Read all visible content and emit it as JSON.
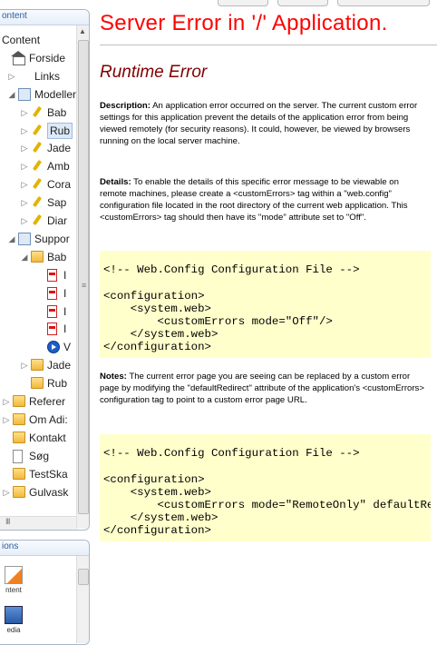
{
  "left_panel": {
    "header": "ontent",
    "tree": [
      {
        "label": "Content",
        "indent": 0,
        "icon": "none",
        "exp": ""
      },
      {
        "label": "Forside",
        "indent": 0,
        "icon": "house",
        "exp": ""
      },
      {
        "label": "Links",
        "indent": 1,
        "icon": "python",
        "exp": "▷"
      },
      {
        "label": "Modeller",
        "indent": 1,
        "icon": "globe",
        "exp": "◢"
      },
      {
        "label": "Bab",
        "indent": 2,
        "icon": "pen",
        "exp": "▷"
      },
      {
        "label": "Rub",
        "indent": 2,
        "icon": "pen",
        "exp": "▷",
        "selected": true
      },
      {
        "label": "Jade",
        "indent": 2,
        "icon": "pen",
        "exp": "▷"
      },
      {
        "label": "Amb",
        "indent": 2,
        "icon": "pen",
        "exp": "▷"
      },
      {
        "label": "Cora",
        "indent": 2,
        "icon": "pen",
        "exp": "▷"
      },
      {
        "label": "Sap",
        "indent": 2,
        "icon": "pen",
        "exp": "▷"
      },
      {
        "label": "Diar",
        "indent": 2,
        "icon": "pen",
        "exp": "▷"
      },
      {
        "label": "Suppor",
        "indent": 1,
        "icon": "globe",
        "exp": "◢"
      },
      {
        "label": "Bab",
        "indent": 2,
        "icon": "folder",
        "exp": "◢"
      },
      {
        "label": "I",
        "indent": 3,
        "icon": "pdf",
        "exp": ""
      },
      {
        "label": "I",
        "indent": 3,
        "icon": "pdf",
        "exp": ""
      },
      {
        "label": "I",
        "indent": 3,
        "icon": "pdf",
        "exp": ""
      },
      {
        "label": "I",
        "indent": 3,
        "icon": "pdf",
        "exp": ""
      },
      {
        "label": "V",
        "indent": 3,
        "icon": "play",
        "exp": ""
      },
      {
        "label": "Jade",
        "indent": 2,
        "icon": "folder",
        "exp": "▷"
      },
      {
        "label": "Rub",
        "indent": 2,
        "icon": "folder",
        "exp": ""
      },
      {
        "label": "Referer",
        "indent": 0,
        "icon": "folder",
        "exp": "▷"
      },
      {
        "label": "Om Adi:",
        "indent": 0,
        "icon": "folder",
        "exp": "▷"
      },
      {
        "label": "Kontakt",
        "indent": 0,
        "icon": "folder",
        "exp": ""
      },
      {
        "label": "Søg",
        "indent": 0,
        "icon": "doc",
        "exp": ""
      },
      {
        "label": "TestSka",
        "indent": 0,
        "icon": "folder",
        "exp": ""
      },
      {
        "label": "Gulvask",
        "indent": 0,
        "icon": "folder",
        "exp": "▷"
      }
    ],
    "grip": "≡",
    "hgrip": "III"
  },
  "options_panel": {
    "header": "ions",
    "items": [
      "ntent",
      "edia"
    ]
  },
  "error_page": {
    "title": "Server Error in '/' Application.",
    "subtitle": "Runtime Error",
    "description_label": "Description:",
    "description_text": " An application error occurred on the server. The current custom error settings for this application prevent the details of the application error from being viewed remotely (for security reasons). It could, however, be viewed by browsers running on the local server machine.",
    "details_label": "Details:",
    "details_text": " To enable the details of this specific error message to be viewable on remote machines, please create a <customErrors> tag within a \"web.config\" configuration file located in the root directory of the current web application. This <customErrors> tag should then have its \"mode\" attribute set to \"Off\".",
    "code1": "\n<!-- Web.Config Configuration File -->\n\n<configuration>\n    <system.web>\n        <customErrors mode=\"Off\"/>\n    </system.web>\n</configuration>",
    "notes_label": "Notes:",
    "notes_text": " The current error page you are seeing can be replaced by a custom error page by modifying the \"defaultRedirect\" attribute of the application's <customErrors> configuration tag to point to a custom error page URL.",
    "code2": "\n<!-- Web.Config Configuration File -->\n\n<configuration>\n    <system.web>\n        <customErrors mode=\"RemoteOnly\" defaultRedirect=\"mycustompage.htm\"/>\n    </system.web>\n</configuration>"
  }
}
